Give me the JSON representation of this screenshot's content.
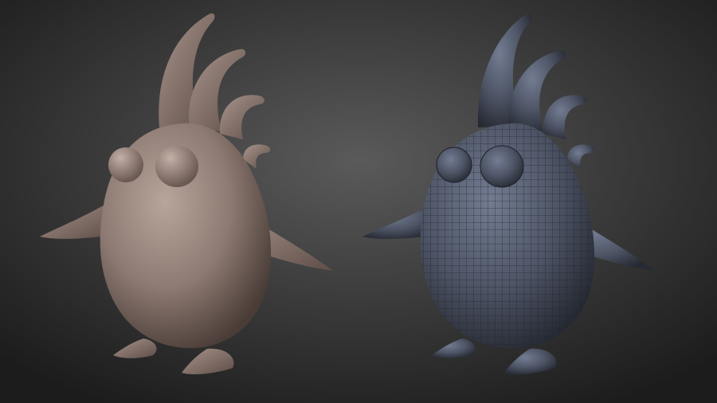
{
  "scene": {
    "background": {
      "center": "#5a5a5a",
      "edge": "#1c1c1c"
    },
    "models": [
      {
        "kind": "sculpt-smooth",
        "fill": "#8d7a72",
        "shade": "#5b4b45",
        "highlight": "#b7a59c"
      },
      {
        "kind": "sculpt-wireframe",
        "fill": "#4e5566",
        "shade": "#2c313d",
        "highlight": "#737c92",
        "wire": "#1d2129"
      }
    ]
  }
}
